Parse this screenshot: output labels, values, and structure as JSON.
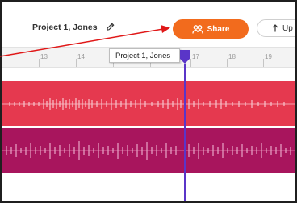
{
  "header": {
    "project_title": "Project 1, Jones",
    "share_label": "Share",
    "upload_label": "Up"
  },
  "tooltip": {
    "text": "Project 1, Jones"
  },
  "ruler": {
    "labels": [
      "13",
      "14",
      "17",
      "18",
      "19"
    ]
  },
  "colors": {
    "share": "#f26b1d",
    "track_1": "#e5394f",
    "track_2": "#a8155d",
    "playhead": "#5a35c8",
    "annotation_arrow": "#e01818"
  },
  "icons": {
    "edit": "pencil-icon",
    "share": "share-icon",
    "upload": "upload-arrow-icon",
    "playhead": "playhead-marker-icon"
  }
}
